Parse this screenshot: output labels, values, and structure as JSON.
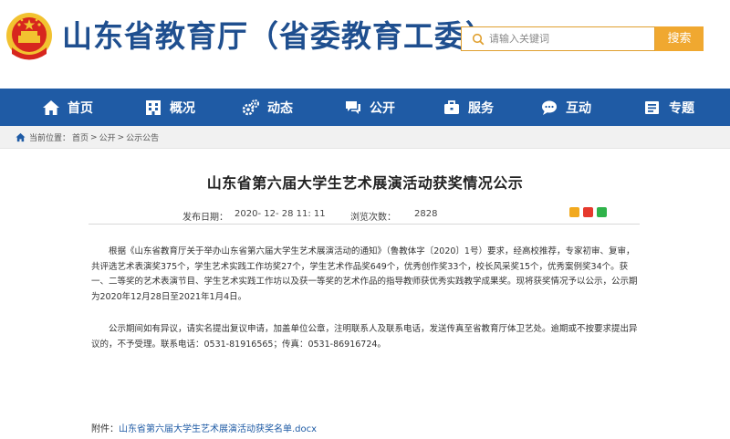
{
  "header": {
    "site_title": "山东省教育厅（省委教育工委）",
    "search_placeholder": "请输入关键词",
    "search_button": "搜索"
  },
  "nav": {
    "items": [
      {
        "label": "首页",
        "icon": "home-icon"
      },
      {
        "label": "概况",
        "icon": "building-icon"
      },
      {
        "label": "动态",
        "icon": "gears-icon"
      },
      {
        "label": "公开",
        "icon": "chat-icon"
      },
      {
        "label": "服务",
        "icon": "briefcase-icon"
      },
      {
        "label": "互动",
        "icon": "comment-icon"
      },
      {
        "label": "专题",
        "icon": "folder-icon"
      }
    ]
  },
  "breadcrumb": {
    "prefix": "当前位置：",
    "home": "首页",
    "sep1": ">",
    "level1": "公开",
    "sep2": ">",
    "level2": "公示公告"
  },
  "article": {
    "title": "山东省第六届大学生艺术展演活动获奖情况公示",
    "publish_label": "发布日期：",
    "publish_date": "2020- 12- 28 11: 11",
    "views_label": "浏览次数：",
    "views_count": "2828",
    "paragraph1": "根据《山东省教育厅关于举办山东省第六届大学生艺术展演活动的通知》（鲁教体字〔2020〕1号）要求，经高校推荐，专家初审、复审，共评选艺术表演奖375个，学生艺术实践工作坊奖27个，学生艺术作品奖649个，优秀创作奖33个，校长风采奖15个，优秀案例奖34个。获一、二等奖的艺术表演节目、学生艺术实践工作坊以及获一等奖的艺术作品的指导教师获优秀实践教学成果奖。现将获奖情况予以公示，公示期为2020年12月28日至2021年1月4日。",
    "paragraph2": "公示期间如有异议，请实名提出复议申请，加盖单位公章，注明联系人及联系电话，发送传真至省教育厅体卫艺处。逾期或不按要求提出异议的，不予受理。联系电话：0531-81916565；传真：0531-86916724。",
    "attachment_label": "附件：",
    "attachment_name": "山东省第六届大学生艺术展演活动获奖名单.docx"
  },
  "colors": {
    "brand_blue": "#1f5ba5",
    "title_blue": "#1f4f8f",
    "search_orange": "#f0a830"
  }
}
